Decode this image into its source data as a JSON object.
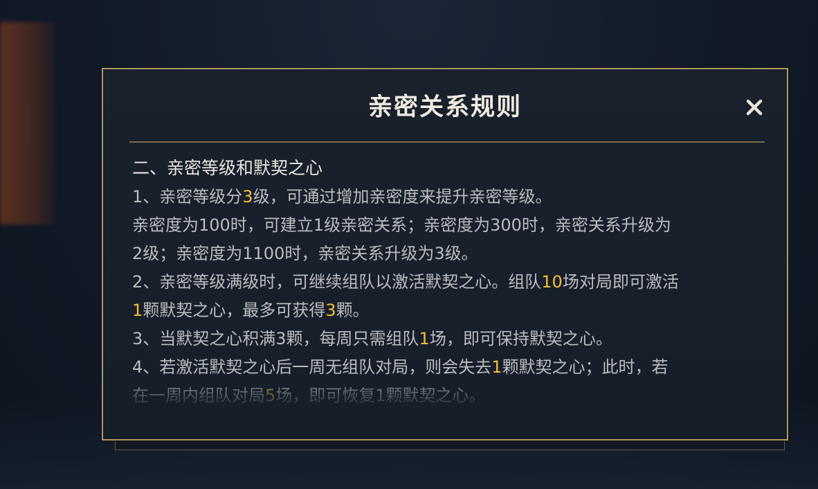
{
  "modal": {
    "title": "亲密关系规则",
    "close_icon": "close-icon",
    "accent_color": "#f3bf36",
    "border_color": "#b39a62"
  },
  "rules": {
    "section_heading": "二、亲密等级和默契之心",
    "rule1": {
      "a": "1、亲密等级分",
      "n1": "3",
      "b": "级，可通过增加亲密度来提升亲密等级。"
    },
    "rule1_detail": {
      "line1": "亲密度为100时，可建立1级亲密关系；亲密度为300时，亲密关系升级为",
      "line2": "2级；亲密度为1100时，亲密关系升级为3级。"
    },
    "rule2": {
      "a": "2、亲密等级满级时，可继续组队以激活默契之心。组队",
      "n1": "10",
      "b": "场对局即可激活",
      "n2": "1",
      "c": "颗默契之心，最多可获得",
      "n3": "3",
      "d": "颗。"
    },
    "rule3": {
      "a": "3、当默契之心积满3颗，每周只需组队",
      "n1": "1",
      "b": "场，即可保持默契之心。"
    },
    "rule4": {
      "a": "4、若激活默契之心后一周无组队对局，则会失去",
      "n1": "1",
      "b": "颗默契之心；此时，若",
      "c": "在一周内组队对局",
      "n2": "5",
      "d": "场，即可恢复1颗默契之心。"
    }
  }
}
